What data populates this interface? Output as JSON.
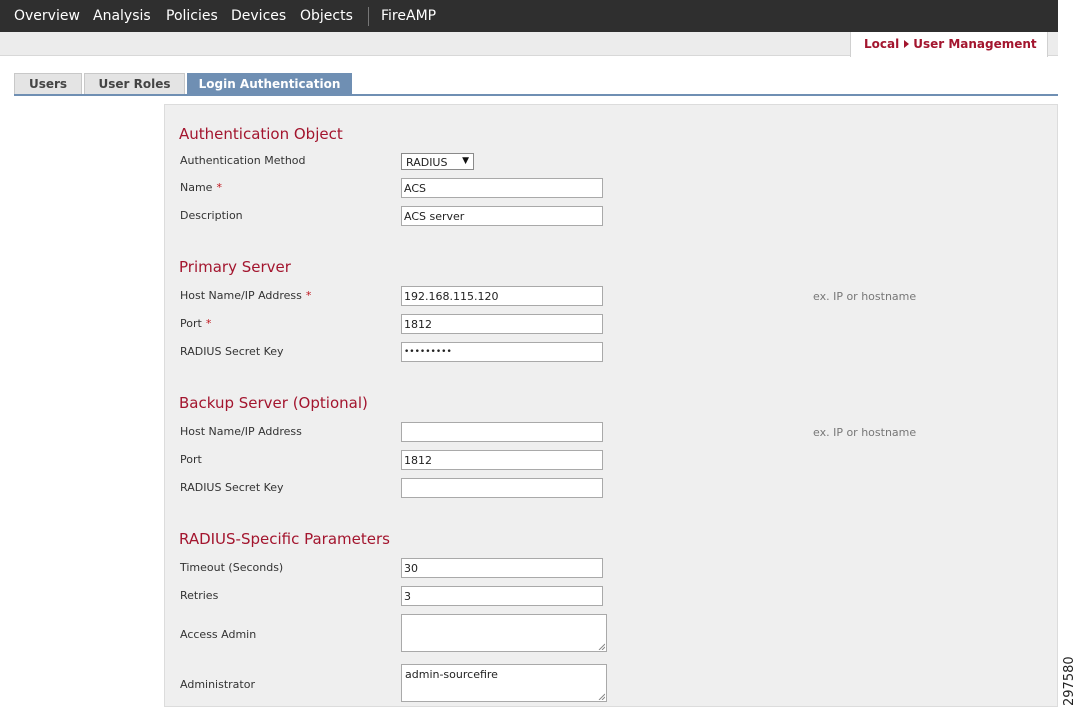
{
  "nav": {
    "items": [
      "Overview",
      "Analysis",
      "Policies",
      "Devices",
      "Objects",
      "FireAMP"
    ]
  },
  "breadcrumb": {
    "parent": "Local",
    "current": "User Management"
  },
  "tabs": [
    "Users",
    "User Roles",
    "Login Authentication"
  ],
  "active_tab": "Login Authentication",
  "auth_object": {
    "title": "Authentication Object",
    "method_label": "Authentication Method",
    "method_value": "RADIUS",
    "name_label": "Name",
    "name_value": "ACS",
    "description_label": "Description",
    "description_value": "ACS server"
  },
  "required_marker": "*",
  "primary_server": {
    "title": "Primary Server",
    "host_label": "Host Name/IP Address",
    "host_value": "192.168.115.120",
    "host_hint": "ex. IP or hostname",
    "port_label": "Port",
    "port_value": "1812",
    "secret_label": "RADIUS Secret Key",
    "secret_value": "•••••••••"
  },
  "backup_server": {
    "title": "Backup Server (Optional)",
    "host_label": "Host Name/IP Address",
    "host_value": "",
    "host_hint": "ex. IP or hostname",
    "port_label": "Port",
    "port_value": "1812",
    "secret_label": "RADIUS Secret Key",
    "secret_value": ""
  },
  "radius_params": {
    "title": "RADIUS-Specific Parameters",
    "timeout_label": "Timeout (Seconds)",
    "timeout_value": "30",
    "retries_label": "Retries",
    "retries_value": "3",
    "access_admin_label": "Access Admin",
    "access_admin_value": "",
    "administrator_label": "Administrator",
    "administrator_value": "admin-sourcefire"
  },
  "figure_id": "297580",
  "colors": {
    "nav_bg": "#2f2f2f",
    "accent_red": "#a3152e",
    "tab_active": "#6f8fb3",
    "panel_bg": "#efefef"
  }
}
